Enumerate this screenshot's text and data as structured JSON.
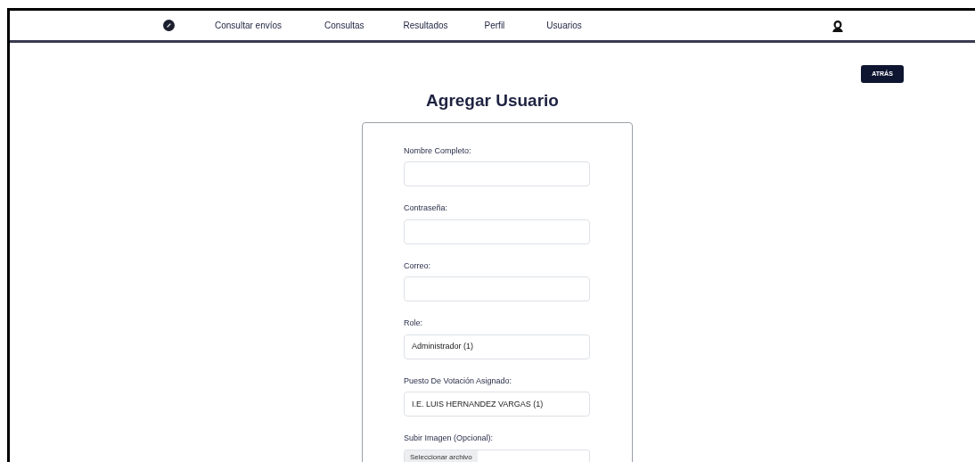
{
  "nav": {
    "links": [
      {
        "label": "Consultar envíos"
      },
      {
        "label": "Consultas"
      },
      {
        "label": "Resultados"
      },
      {
        "label": "Perfil"
      },
      {
        "label": "Usuarios"
      }
    ]
  },
  "back_button": "ATRÁS",
  "title": "Agregar Usuario",
  "form": {
    "fields": [
      {
        "kind": "text",
        "label": "Nombre Completo:"
      },
      {
        "kind": "text",
        "label": "Contraseña:"
      },
      {
        "kind": "text",
        "label": "Correo:"
      },
      {
        "kind": "select",
        "label": "Role:",
        "value": "Administrador (1)"
      },
      {
        "kind": "select",
        "label": "Puesto De Votación Asignado:",
        "value": "I.E. LUIS HERNANDEZ VARGAS (1)"
      },
      {
        "kind": "file",
        "label": "Subir Imagen (Opcional):",
        "button": "Seleccionar archivo"
      }
    ]
  }
}
